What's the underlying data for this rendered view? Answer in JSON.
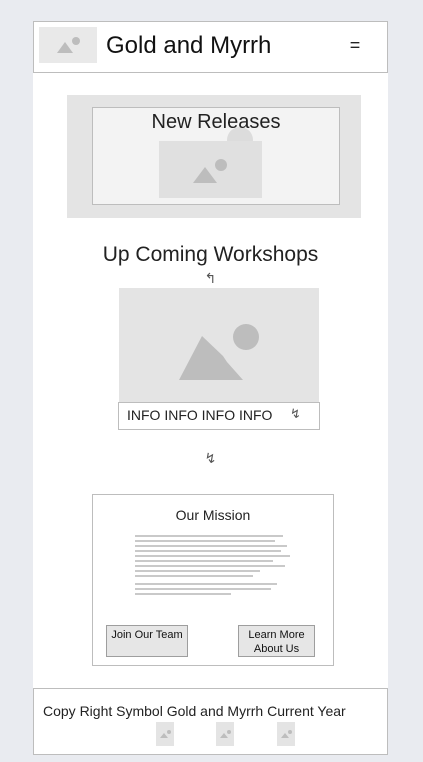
{
  "header": {
    "brand": "Gold and Myrrh",
    "menu_symbol": "="
  },
  "new_releases": {
    "title": "New Releases"
  },
  "workshops": {
    "title": "Up Coming Workshops",
    "arrow_symbol": "↰",
    "info_text": "INFO INFO INFO INFO",
    "bolt_symbol": "↯",
    "arrow_down_symbol": "↯"
  },
  "mission": {
    "title": "Our Mission",
    "join_button": "Join Our Team",
    "learn_button_line1": "Learn More",
    "learn_button_line2": "About Us"
  },
  "footer": {
    "copyright": "Copy Right Symbol Gold and Myrrh Current Year"
  },
  "colors": {
    "background": "#e9ebf0",
    "placeholder": "#e4e4e4",
    "border": "#bdbdbd",
    "button": "#e6e6e6"
  }
}
